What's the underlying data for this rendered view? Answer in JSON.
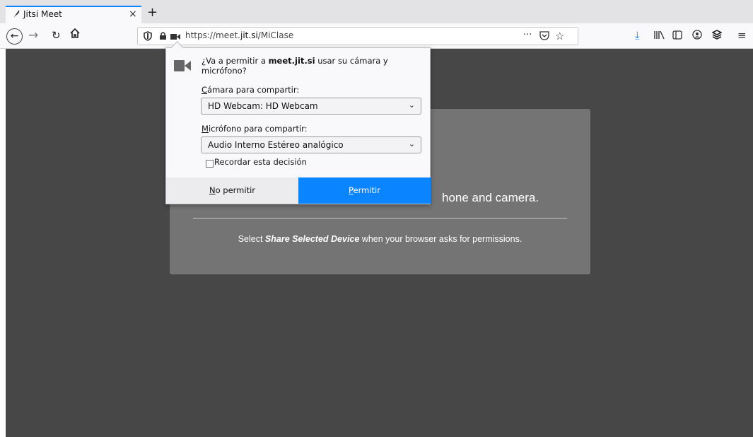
{
  "tab": {
    "title": "Jitsi Meet",
    "favicon": "jitsi-feather-icon",
    "close_glyph": "×",
    "new_tab_glyph": "+"
  },
  "nav": {
    "url_prefix": "https://meet.",
    "url_domain": "jit.si",
    "url_path": "/MiClase",
    "icons": [
      "back-icon",
      "forward-icon",
      "reload-icon",
      "home-icon",
      "tracking-shield-icon",
      "lock-icon",
      "camera-permission-icon",
      "page-actions-icon",
      "pocket-icon",
      "bookmark-star-icon",
      "download-icon",
      "library-icon",
      "sidebar-icon",
      "account-icon",
      "extension-icon",
      "menu-icon"
    ]
  },
  "popup": {
    "question_prefix": "¿Va a permitir a ",
    "question_domain": "meet.jit.si",
    "question_suffix": " usar su cámara y micrófono?",
    "camera_label_u": "C",
    "camera_label_rest": "ámara para compartir:",
    "camera_value": "HD Webcam: HD Webcam",
    "mic_label_u": "M",
    "mic_label_rest": "icrófono para compartir:",
    "mic_value": "Audio Interno Estéreo analógico",
    "remember_label": "Recordar esta decisión",
    "remember_checked": false,
    "deny_u": "N",
    "deny_rest": "o permitir",
    "allow_u": "P",
    "allow_rest": "ermitir"
  },
  "page": {
    "heading_visible": "hone and camera.",
    "instruction_prefix": "Select ",
    "instruction_bold": "Share Selected Device",
    "instruction_suffix": " when your browser asks for permissions."
  },
  "colors": {
    "accent": "#0a84ff",
    "page_bg": "#474747",
    "card_bg": "#747474",
    "download_icon": "#0a84ff"
  }
}
